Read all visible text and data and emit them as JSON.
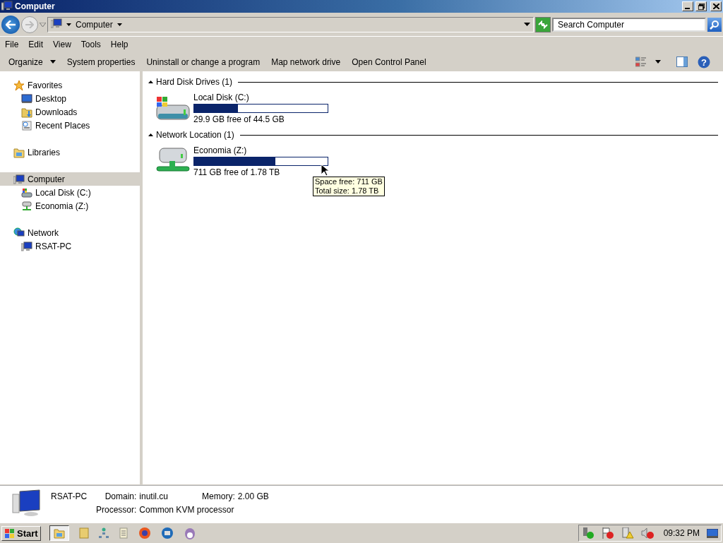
{
  "window": {
    "title": "Computer"
  },
  "address": {
    "crumbs": [
      "Computer"
    ],
    "search_placeholder": "Search Computer"
  },
  "menu": [
    "File",
    "Edit",
    "View",
    "Tools",
    "Help"
  ],
  "commands": [
    {
      "label": "Organize",
      "dropdown": true
    },
    {
      "label": "System properties",
      "dropdown": false
    },
    {
      "label": "Uninstall or change a program",
      "dropdown": false
    },
    {
      "label": "Map network drive",
      "dropdown": false
    },
    {
      "label": "Open Control Panel",
      "dropdown": false
    }
  ],
  "sidebar": {
    "groups": [
      {
        "label": "Favorites",
        "selected": false,
        "children": [
          {
            "label": "Desktop",
            "selected": false
          },
          {
            "label": "Downloads",
            "selected": false
          },
          {
            "label": "Recent Places",
            "selected": false
          }
        ]
      },
      {
        "label": "Libraries",
        "selected": false
      },
      {
        "label": "Computer",
        "selected": true,
        "children": [
          {
            "label": "Local Disk (C:)",
            "selected": false
          },
          {
            "label": "Economia (Z:)",
            "selected": false
          }
        ]
      },
      {
        "label": "Network",
        "selected": false,
        "children": [
          {
            "label": "RSAT-PC",
            "selected": false
          }
        ]
      }
    ]
  },
  "sections": [
    {
      "title": "Hard Disk Drives (1)",
      "drives": [
        {
          "kind": "local",
          "name": "Local Disk (C:)",
          "level": 0.33,
          "reading": "29.9 GB free of 44.5 GB"
        }
      ]
    },
    {
      "title": "Network Location (1)",
      "drives": [
        {
          "kind": "network",
          "name": "Economia (Z:)",
          "level": 0.61,
          "reading": "711 GB free of 1.78 TB"
        }
      ]
    }
  ],
  "tooltip": [
    "Space free: 711 GB",
    "Total size: 1.78 TB"
  ],
  "details": {
    "name": "RSAT-PC",
    "fields": [
      {
        "label": "Domain:",
        "value": "inutil.cu"
      },
      {
        "label": "Memory:",
        "value": "2.00 GB"
      },
      {
        "label": "Processor:",
        "value": "Common KVM processor"
      }
    ]
  },
  "taskbar": {
    "start": "Start",
    "clock": "09:32 PM"
  },
  "help_glyph": "?"
}
